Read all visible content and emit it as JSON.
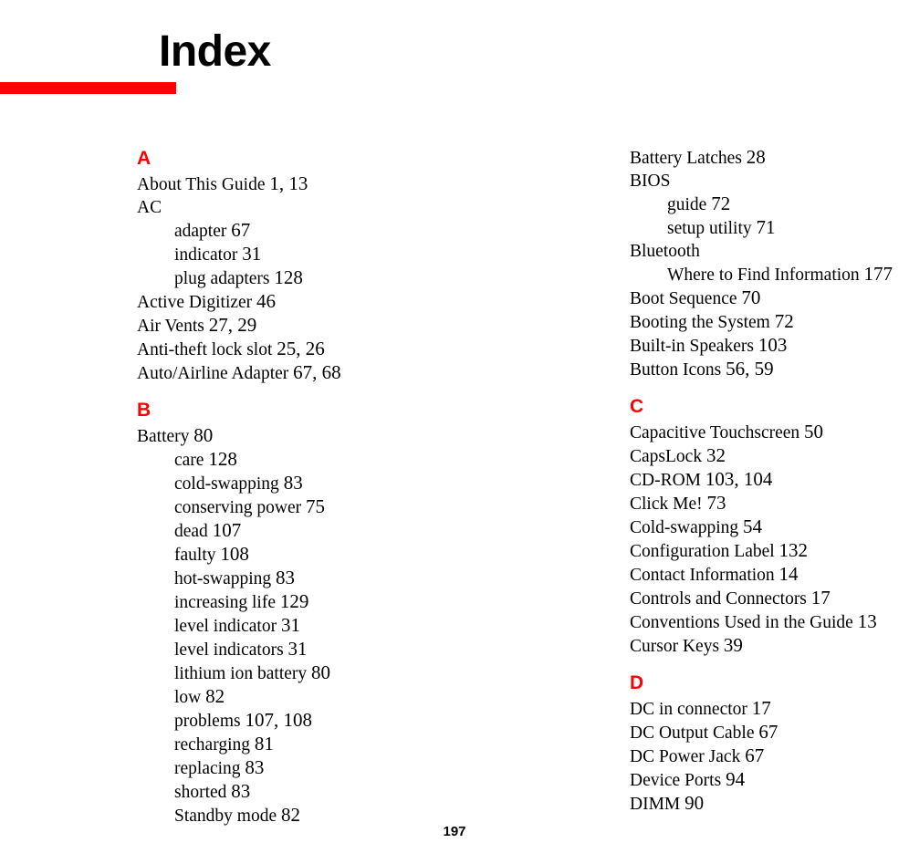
{
  "page": {
    "title": "Index",
    "folio": "197",
    "accent_color": "#FF0000",
    "text_color": "#000000",
    "background_color": "#FFFFFF"
  },
  "columns": [
    {
      "name": "left-column",
      "sections": [
        {
          "letter": "A",
          "entries": [
            {
              "level": 1,
              "text": "About This Guide",
              "pages": "1, 13"
            },
            {
              "level": 1,
              "text": "AC",
              "pages": ""
            },
            {
              "level": 2,
              "text": "adapter",
              "pages": "67"
            },
            {
              "level": 2,
              "text": "indicator",
              "pages": "31"
            },
            {
              "level": 2,
              "text": "plug adapters",
              "pages": "128"
            },
            {
              "level": 1,
              "text": "Active Digitizer",
              "pages": "46"
            },
            {
              "level": 1,
              "text": "Air Vents",
              "pages": "27, 29"
            },
            {
              "level": 1,
              "text": "Anti-theft lock slot",
              "pages": "25, 26"
            },
            {
              "level": 1,
              "text": "Auto/Airline Adapter",
              "pages": "67, 68"
            }
          ]
        },
        {
          "letter": "B",
          "entries": [
            {
              "level": 1,
              "text": "Battery",
              "pages": "80"
            },
            {
              "level": 2,
              "text": "care",
              "pages": "128"
            },
            {
              "level": 2,
              "text": "cold-swapping",
              "pages": "83"
            },
            {
              "level": 2,
              "text": "conserving power",
              "pages": "75"
            },
            {
              "level": 2,
              "text": "dead",
              "pages": "107"
            },
            {
              "level": 2,
              "text": "faulty",
              "pages": "108"
            },
            {
              "level": 2,
              "text": "hot-swapping",
              "pages": "83"
            },
            {
              "level": 2,
              "text": "increasing life",
              "pages": "129"
            },
            {
              "level": 2,
              "text": "level indicator",
              "pages": "31"
            },
            {
              "level": 2,
              "text": "level indicators",
              "pages": "31"
            },
            {
              "level": 2,
              "text": "lithium ion battery",
              "pages": "80"
            },
            {
              "level": 2,
              "text": "low",
              "pages": "82"
            },
            {
              "level": 2,
              "text": "problems",
              "pages": "107, 108"
            },
            {
              "level": 2,
              "text": "recharging",
              "pages": "81"
            },
            {
              "level": 2,
              "text": "replacing",
              "pages": "83"
            },
            {
              "level": 2,
              "text": "shorted",
              "pages": "83"
            },
            {
              "level": 2,
              "text": "Standby mode",
              "pages": "82"
            }
          ]
        }
      ]
    },
    {
      "name": "right-column",
      "sections": [
        {
          "letter": "",
          "entries": [
            {
              "level": 1,
              "text": "Battery Latches",
              "pages": "28"
            },
            {
              "level": 1,
              "text": "BIOS",
              "pages": ""
            },
            {
              "level": 2,
              "text": "guide",
              "pages": "72"
            },
            {
              "level": 2,
              "text": "setup utility",
              "pages": "71"
            },
            {
              "level": 1,
              "text": "Bluetooth",
              "pages": ""
            },
            {
              "level": 2,
              "text": "Where to Find Information",
              "pages": "177"
            },
            {
              "level": 1,
              "text": "Boot Sequence",
              "pages": "70"
            },
            {
              "level": 1,
              "text": "Booting the System",
              "pages": "72"
            },
            {
              "level": 1,
              "text": "Built-in Speakers",
              "pages": "103"
            },
            {
              "level": 1,
              "text": "Button Icons",
              "pages": "56, 59"
            }
          ]
        },
        {
          "letter": "C",
          "entries": [
            {
              "level": 1,
              "text": "Capacitive Touchscreen",
              "pages": "50"
            },
            {
              "level": 1,
              "text": "CapsLock",
              "pages": "32"
            },
            {
              "level": 1,
              "text": "CD-ROM",
              "pages": "103, 104"
            },
            {
              "level": 1,
              "text": "Click Me!",
              "pages": "73"
            },
            {
              "level": 1,
              "text": "Cold-swapping",
              "pages": "54"
            },
            {
              "level": 1,
              "text": "Configuration Label",
              "pages": "132"
            },
            {
              "level": 1,
              "text": "Contact Information",
              "pages": "14"
            },
            {
              "level": 1,
              "text": "Controls and Connectors",
              "pages": "17"
            },
            {
              "level": 1,
              "text": "Conventions Used in the Guide",
              "pages": "13"
            },
            {
              "level": 1,
              "text": "Cursor Keys",
              "pages": "39"
            }
          ]
        },
        {
          "letter": "D",
          "entries": [
            {
              "level": 1,
              "text": "DC in connector",
              "pages": "17"
            },
            {
              "level": 1,
              "text": "DC Output Cable",
              "pages": "67"
            },
            {
              "level": 1,
              "text": "DC Power Jack",
              "pages": "67"
            },
            {
              "level": 1,
              "text": "Device Ports",
              "pages": "94"
            },
            {
              "level": 1,
              "text": "DIMM",
              "pages": "90"
            }
          ]
        }
      ]
    }
  ]
}
